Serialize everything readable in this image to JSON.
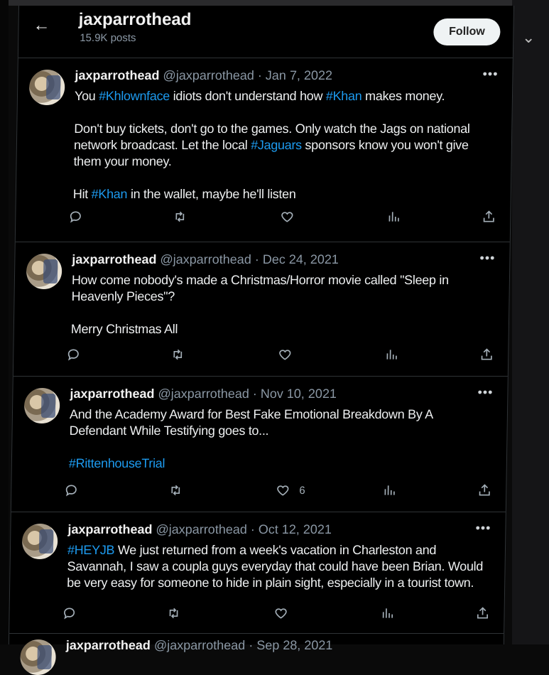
{
  "profile": {
    "title": "jaxparrothead",
    "posts_count": "15.9K posts",
    "follow_label": "Follow"
  },
  "tweets": [
    {
      "name": "jaxparrothead",
      "handle": "@jaxparrothead",
      "date": "· Jan 7, 2022",
      "p1_a": "You ",
      "p1_tag1": "#Khlownface",
      "p1_b": " idiots don't understand how ",
      "p1_tag2": "#Khan",
      "p1_c": " makes money.",
      "p2_a": "Don't buy tickets, don't go to the games. Only watch the Jags on national network broadcast. Let the local ",
      "p2_tag": "#Jaguars",
      "p2_b": " sponsors know you won't give them your money.",
      "p3_a": "Hit ",
      "p3_tag": "#Khan",
      "p3_b": " in the wallet, maybe he'll listen",
      "likes": ""
    },
    {
      "name": "jaxparrothead",
      "handle": "@jaxparrothead",
      "date": "· Dec 24, 2021",
      "p1": "How come nobody's made a Christmas/Horror movie called \"Sleep in Heavenly Pieces\"?",
      "p2": "Merry Christmas All",
      "likes": ""
    },
    {
      "name": "jaxparrothead",
      "handle": "@jaxparrothead",
      "date": "· Nov 10, 2021",
      "p1": "And the Academy Award for Best Fake Emotional Breakdown By A Defendant While Testifying goes to...",
      "p2_tag": "#RittenhouseTrial",
      "likes": "6"
    },
    {
      "name": "jaxparrothead",
      "handle": "@jaxparrothead",
      "date": "· Oct 12, 2021",
      "p1_tag": "#HEYJB",
      "p1_b": " We just returned from a week's vacation in Charleston and Savannah, I saw a coupla guys everyday that could have been Brian. Would be very easy for someone to hide in plain sight, especially in a tourist town.",
      "likes": ""
    },
    {
      "name": "jaxparrothead",
      "handle": "@jaxparrothead",
      "date": "· Sep 28, 2021"
    }
  ],
  "icons": {
    "back": "back-arrow-icon",
    "more": "more-icon",
    "reply": "reply-icon",
    "retweet": "retweet-icon",
    "like": "like-icon",
    "views": "views-icon",
    "share": "share-icon"
  },
  "colors": {
    "background": "#000000",
    "text": "#e7e9ea",
    "secondary_text": "#8b98a5",
    "hashtag": "#1d9bf0",
    "divider": "#2f3336",
    "follow_button_bg": "#eff3f4"
  }
}
